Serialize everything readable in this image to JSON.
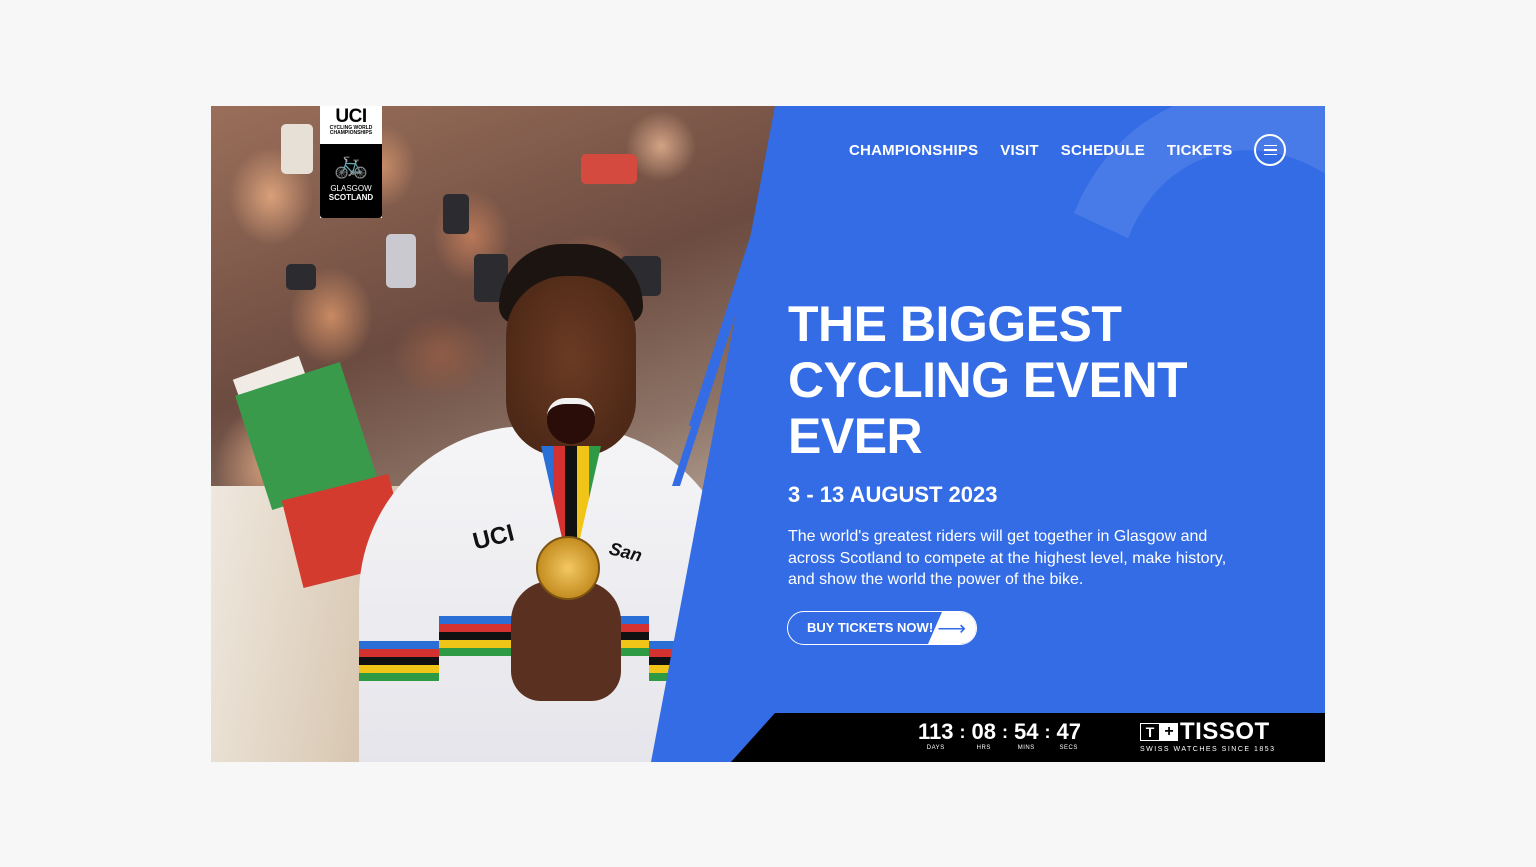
{
  "logo": {
    "brand": "UCI",
    "subtitle": "CYCLING WORLD CHAMPIONSHIPS",
    "year": "2023",
    "city": "GLASGOW",
    "country": "SCOTLAND"
  },
  "nav": {
    "items": [
      "CHAMPIONSHIPS",
      "VISIT",
      "SCHEDULE",
      "TICKETS"
    ],
    "menu_icon": "hamburger-menu-icon"
  },
  "hero": {
    "headline": [
      "THE BIGGEST",
      "CYCLING EVENT",
      "EVER"
    ],
    "date": "3 - 13 AUGUST 2023",
    "description": "The world's greatest riders will get together in Glasgow and across Scotland to compete at the highest level, make history, and show the world the power of the bike.",
    "cta_label": "BUY TICKETS NOW!",
    "cta_icon": "arrow-right-icon"
  },
  "photo": {
    "jersey_brand": "UCI",
    "jersey_sponsor": "San"
  },
  "countdown": {
    "units": [
      {
        "value": "113",
        "label": "DAYS"
      },
      {
        "value": "08",
        "label": "HRS"
      },
      {
        "value": "54",
        "label": "MINS"
      },
      {
        "value": "47",
        "label": "SECS"
      }
    ],
    "separator": ":"
  },
  "sponsor": {
    "name": "TISSOT",
    "tagline": "SWISS WATCHES SINCE 1853"
  },
  "colors": {
    "brand_blue": "#346ce6",
    "bar_black": "#000000",
    "page_bg": "#f7f7f8"
  }
}
